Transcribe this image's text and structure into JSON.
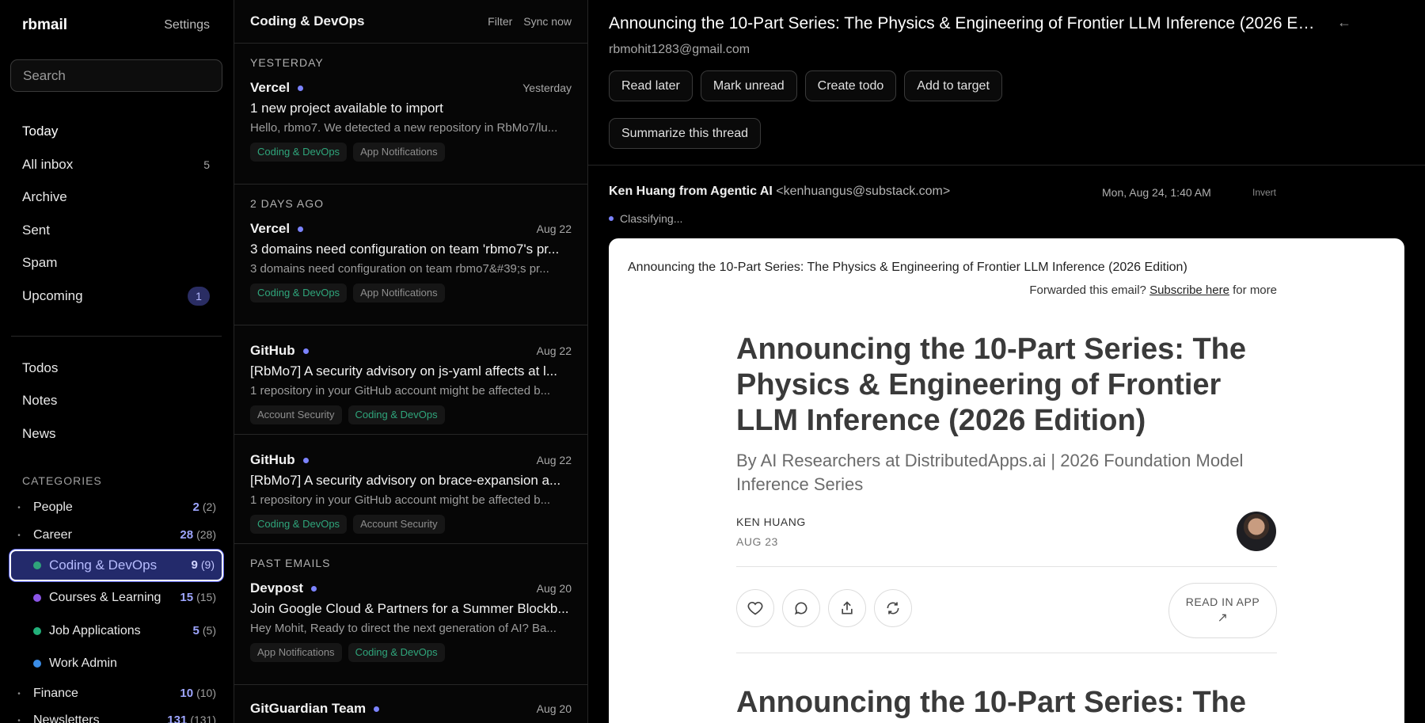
{
  "sidebar": {
    "brand": "rbmail",
    "settings_label": "Settings",
    "search_placeholder": "Search",
    "nav": [
      {
        "label": "Today",
        "count": ""
      },
      {
        "label": "All inbox",
        "count": "5"
      },
      {
        "label": "Archive",
        "count": ""
      },
      {
        "label": "Sent",
        "count": ""
      },
      {
        "label": "Spam",
        "count": ""
      },
      {
        "label": "Upcoming",
        "count": "1"
      }
    ],
    "nav2": [
      {
        "label": "Todos"
      },
      {
        "label": "Notes"
      },
      {
        "label": "News"
      }
    ],
    "categories_title": "CATEGORIES",
    "categories": [
      {
        "label": "People",
        "count": "2",
        "total": "(2)"
      },
      {
        "label": "Career",
        "count": "28",
        "total": "(28)"
      },
      {
        "label": "Coding & DevOps",
        "count": "9",
        "total": "(9)",
        "color": "#2fa57b"
      },
      {
        "label": "Courses & Learning",
        "count": "15",
        "total": "(15)",
        "color": "#8b55e6"
      },
      {
        "label": "Job Applications",
        "count": "5",
        "total": "(5)",
        "color": "#22b07a"
      },
      {
        "label": "Work Admin",
        "count": "",
        "total": "",
        "color": "#3b8ee8"
      },
      {
        "label": "Finance",
        "count": "10",
        "total": "(10)"
      },
      {
        "label": "Newsletters",
        "count": "131",
        "total": "(131)"
      }
    ]
  },
  "list": {
    "title": "Coding & DevOps",
    "filter_label": "Filter",
    "sync_label": "Sync now",
    "groups": {
      "yesterday": "YESTERDAY",
      "two_days": "2 DAYS AGO",
      "past": "PAST EMAILS"
    },
    "messages": [
      {
        "from": "Vercel",
        "date": "Yesterday",
        "subject": "1 new project available to import",
        "snippet": "Hello, rbmo7. We detected a new repository in RbMo7/lu...",
        "tags": [
          "Coding & DevOps",
          "App Notifications"
        ]
      },
      {
        "from": "Vercel",
        "date": "Aug 22",
        "subject": "3 domains need configuration on team 'rbmo7's pr...",
        "snippet": "3 domains need configuration on team rbmo7&#39;s pr...",
        "tags": [
          "Coding & DevOps",
          "App Notifications"
        ]
      },
      {
        "from": "GitHub",
        "date": "Aug 22",
        "subject": "[RbMo7] A security advisory on js-yaml affects at l...",
        "snippet": "1 repository in your GitHub account might be affected b...",
        "tags": [
          "Account Security",
          "Coding & DevOps"
        ]
      },
      {
        "from": "GitHub",
        "date": "Aug 22",
        "subject": "[RbMo7] A security advisory on brace-expansion a...",
        "snippet": "1 repository in your GitHub account might be affected b...",
        "tags": [
          "Coding & DevOps",
          "Account Security"
        ]
      },
      {
        "from": "Devpost",
        "date": "Aug 20",
        "subject": "Join Google Cloud & Partners for a Summer Blockb...",
        "snippet": "Hey Mohit, Ready to direct the next generation of AI? Ba...",
        "tags": [
          "App Notifications",
          "Coding & DevOps"
        ]
      },
      {
        "from": "GitGuardian Team",
        "date": "Aug 20",
        "subject": "",
        "snippet": "",
        "tags": []
      }
    ]
  },
  "reader": {
    "title": "Announcing the 10-Part Series: The Physics & Engineering of Frontier LLM Inference (2026 Edi...",
    "to_address": "rbmohit1283@gmail.com",
    "buttons": [
      "Read later",
      "Mark unread",
      "Create todo",
      "Add to target"
    ],
    "summarize_label": "Summarize this thread",
    "sender_name": "Ken Huang from Agentic AI",
    "sender_email": "<kenhuangus@substack.com>",
    "date": "Mon, Aug 24, 1:40 AM",
    "invert_label": "Invert",
    "classifying": "Classifying...",
    "email": {
      "preheader": "Announcing the 10-Part Series: The Physics & Engineering of Frontier LLM Inference (2026 Edition)",
      "forward_text": "Forwarded this email?",
      "subscribe_link": "Subscribe here",
      "forward_suffix": "for more",
      "headline": "Announcing the 10-Part Series: The Physics & Engineering of Frontier LLM Inference (2026 Edition)",
      "subheadline": "By AI Researchers at DistributedApps.ai | 2026 Foundation Model Inference Series",
      "author": "KEN HUANG",
      "author_date": "AUG 23",
      "read_in_app": "READ IN APP",
      "headline_repeat": "Announcing the 10-Part Series: The"
    }
  },
  "colors": {
    "accent": "#7b83ff",
    "selected_bg": "#232a6b",
    "tag_green": "#2fa57b"
  }
}
